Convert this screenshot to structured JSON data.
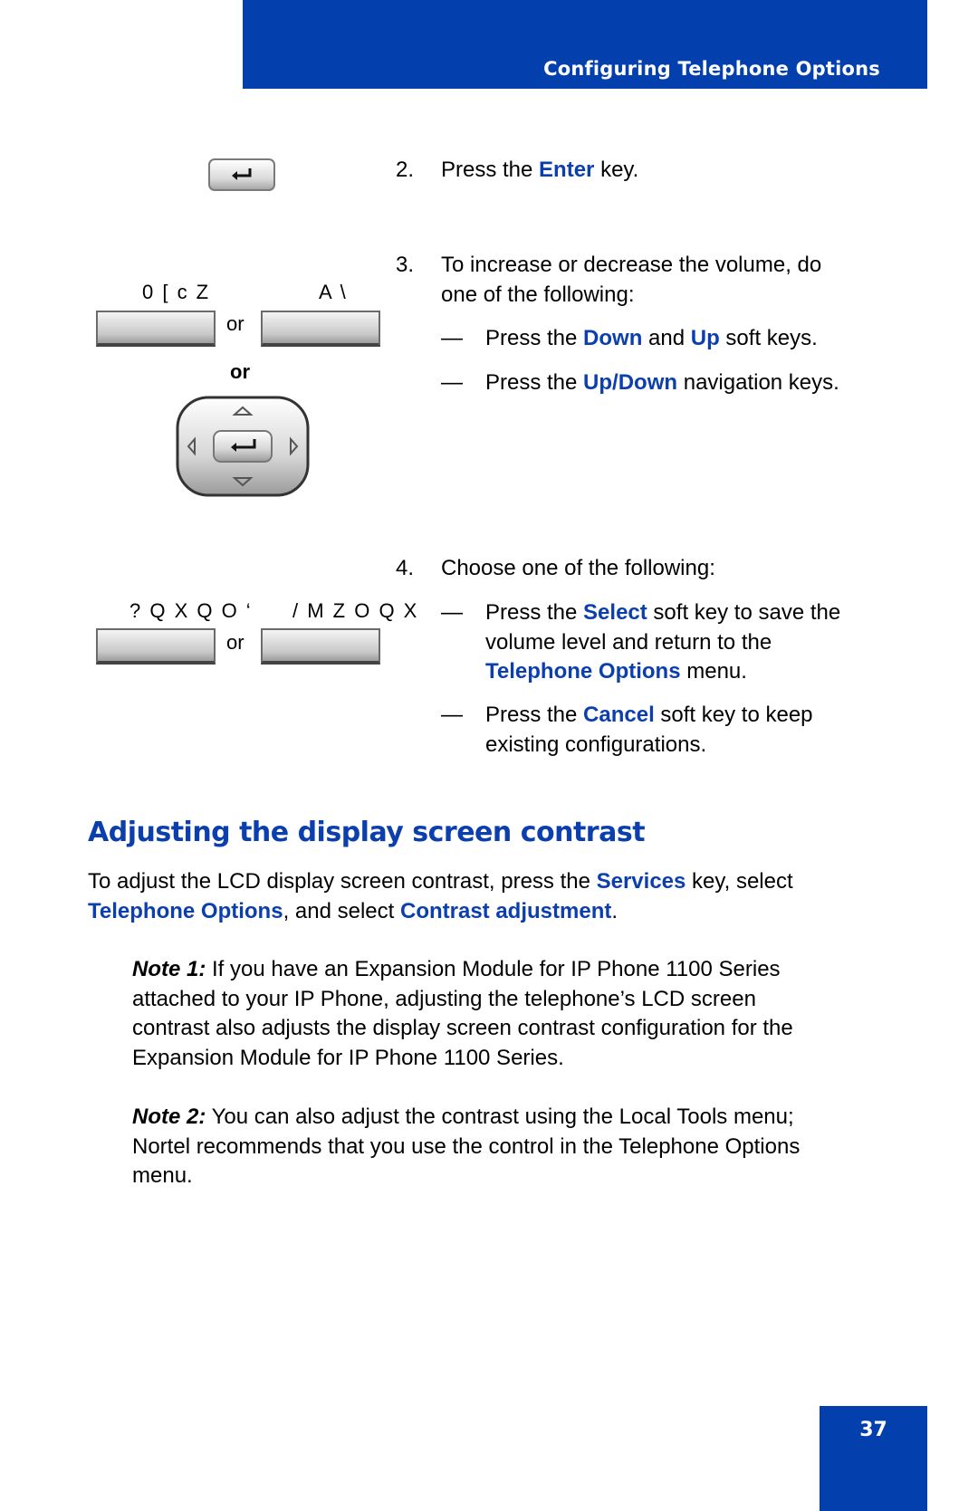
{
  "header": {
    "title": "Configuring Telephone Options"
  },
  "steps": [
    {
      "number": "2.",
      "parts": [
        "Press the ",
        "Enter",
        " key."
      ]
    },
    {
      "number": "3.",
      "line1": "To increase or decrease the volume, do",
      "line2": "one of the following:",
      "options": [
        {
          "dash": "—",
          "parts": [
            "Press the ",
            "Down",
            " and ",
            "Up",
            " soft keys."
          ]
        },
        {
          "dash": "—",
          "parts": [
            "Press the ",
            "Up",
            "/",
            "Down",
            " navigation keys."
          ]
        }
      ]
    },
    {
      "number": "4.",
      "line1": "Choose one of the following:",
      "options": [
        {
          "dash": "—",
          "parts": [
            "Press the ",
            "Select",
            " soft key to save the"
          ],
          "line2": "volume level and return to the",
          "line3_parts": [
            "Telephone Options",
            " menu."
          ]
        },
        {
          "dash": "—",
          "parts": [
            "Press the ",
            "Cancel",
            " soft key to keep"
          ],
          "line2": "existing configurations."
        }
      ]
    }
  ],
  "illustrations": {
    "softkey_labels_1": [
      "0 [ c Z",
      "A \\"
    ],
    "softkey_labels_2": [
      "? Q X Q O ‘",
      "/ M Z O Q X"
    ],
    "or_text": "or",
    "or_bold": "or"
  },
  "section": {
    "title": "Adjusting the display screen contrast",
    "intro_parts": [
      "To adjust the LCD display screen contrast, press the ",
      "Services",
      " key, select"
    ],
    "intro_line2_parts": [
      "Telephone Options",
      ", and select ",
      "Contrast adjustment",
      "."
    ],
    "note1": {
      "label": "Note 1:",
      "lines": [
        " If you have an Expansion Module for IP Phone 1100 Series",
        "attached to your IP Phone, adjusting the telephone’s LCD screen",
        "contrast also adjusts the display screen contrast configuration for the",
        "Expansion Module for IP Phone 1100 Series."
      ]
    },
    "note2": {
      "label": "Note 2:",
      "lines": [
        " You can also adjust the contrast using the Local Tools menu;",
        "Nortel recommends that you use the control in the Telephone Options",
        "menu."
      ]
    }
  },
  "page_number": "37",
  "colors": {
    "brand_blue": "#0340ad",
    "link_blue": "#0c3fae"
  }
}
